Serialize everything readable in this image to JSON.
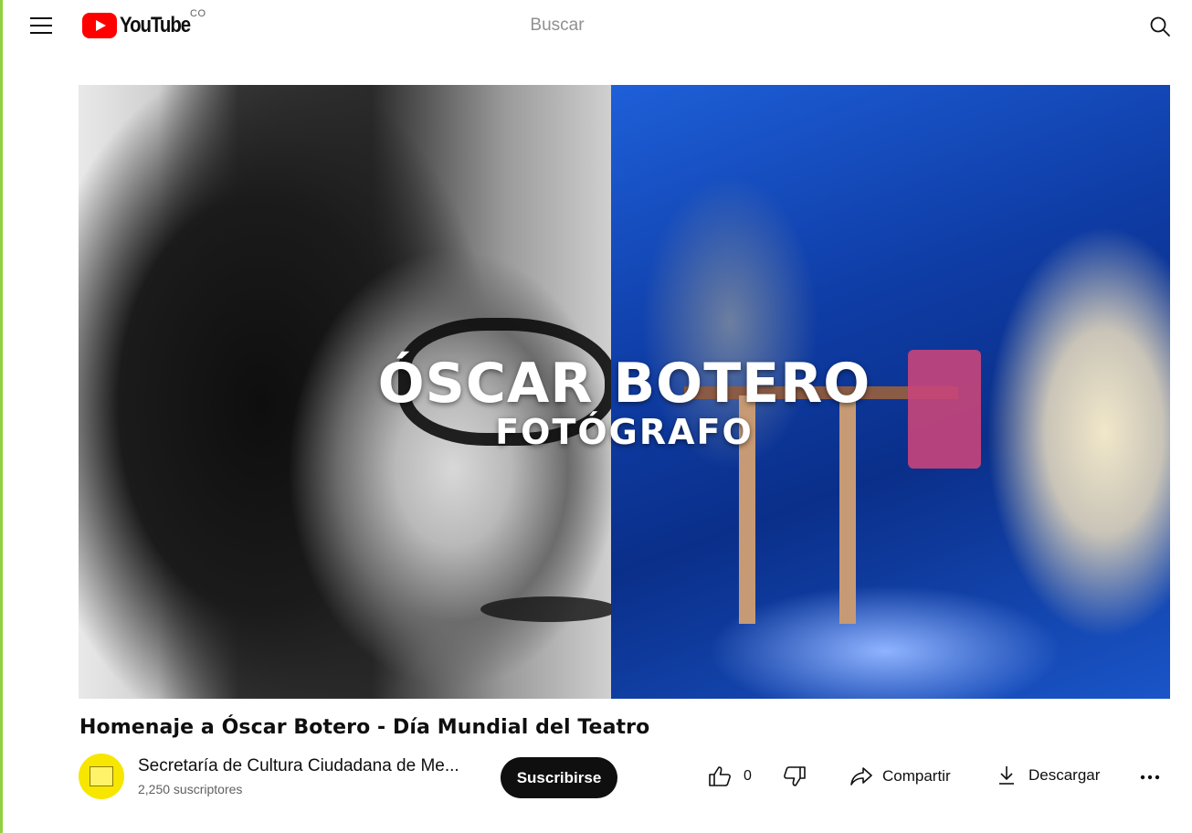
{
  "app": {
    "logo_text": "YouTube",
    "country_code": "CO",
    "brand_color": "#ff0000"
  },
  "header": {
    "menu_icon": "hamburger-menu-icon",
    "search": {
      "placeholder": "Buscar",
      "icon": "search-icon"
    }
  },
  "video": {
    "thumbnail_overlay": {
      "title": "ÓSCAR BOTERO",
      "subtitle": "FOTÓGRAFO"
    },
    "title": "Homenaje a Óscar Botero - Día Mundial del Teatro"
  },
  "channel": {
    "name": "Secretaría de Cultura Ciudadana de Me...",
    "subscribers": "2,250 suscriptores",
    "subscribe_label": "Suscribirse",
    "avatar_color": "#f6e600"
  },
  "actions": {
    "like_count": "0",
    "share_label": "Compartir",
    "download_label": "Descargar"
  }
}
